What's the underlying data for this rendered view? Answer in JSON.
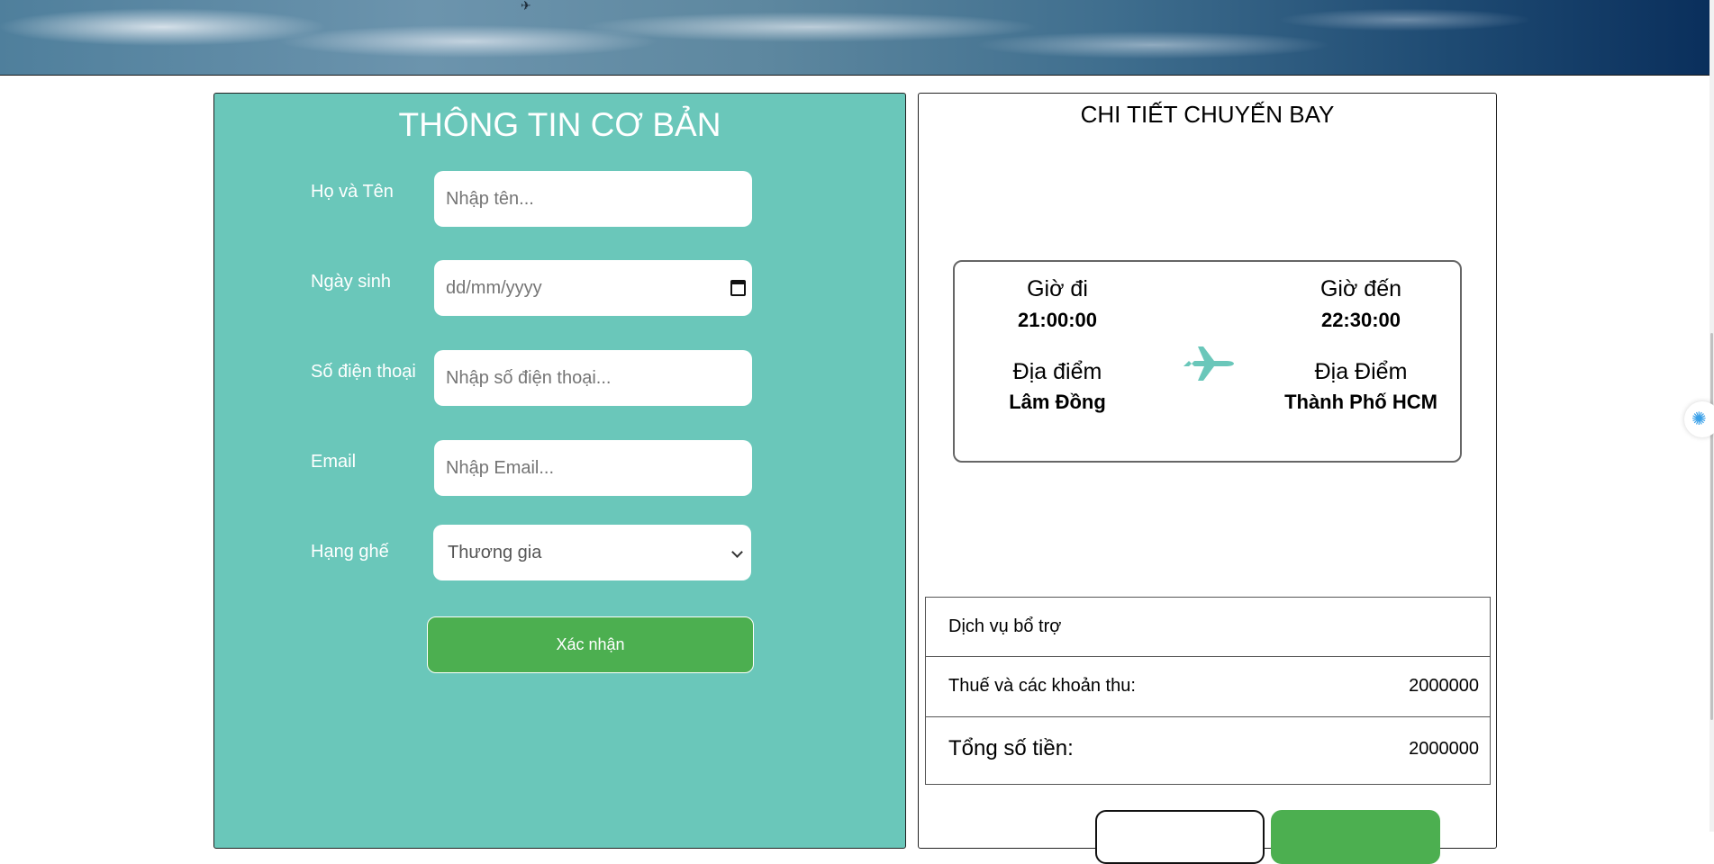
{
  "basic_info": {
    "title": "THÔNG TIN CƠ BẢN",
    "fields": {
      "name": {
        "label": "Họ và Tên",
        "placeholder": "Nhập tên..."
      },
      "dob": {
        "label": "Ngày sinh",
        "placeholder": "dd/mm/yyyy"
      },
      "phone": {
        "label": "Số điện thoại",
        "placeholder": "Nhập số điện thoại..."
      },
      "email": {
        "label": "Email",
        "placeholder": "Nhập Email..."
      },
      "seat_class": {
        "label": "Hạng ghế",
        "selected": "Thương gia"
      }
    },
    "confirm_label": "Xác nhận"
  },
  "flight_detail": {
    "title": "CHI TIẾT CHUYẾN BAY",
    "departure": {
      "time_label": "Giờ đi",
      "time": "21:00:00",
      "place_label": "Địa điểm",
      "place": "Lâm Đồng"
    },
    "arrival": {
      "time_label": "Giờ đến",
      "time": "22:30:00",
      "place_label": "Địa Điểm",
      "place": "Thành Phố HCM"
    },
    "icon": "airplane-icon"
  },
  "summary": {
    "services_label": "Dịch vụ bổ trợ",
    "tax_label": "Thuế và các khoản thu:",
    "tax_value": "2000000",
    "total_label": "Tổng số tiền:",
    "total_value": "2000000"
  },
  "colors": {
    "panel_teal": "#6ac7ba",
    "button_green": "#4caf50",
    "plane_icon": "#6ac7ba"
  }
}
